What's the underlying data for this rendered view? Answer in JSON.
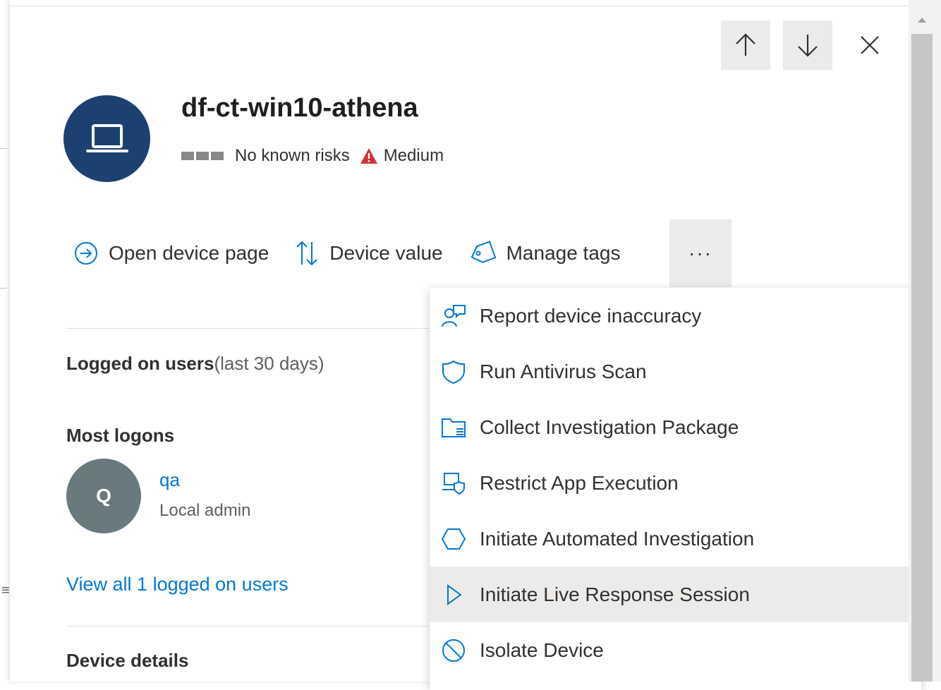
{
  "panel": {
    "nav_up_icon": "arrow-up-icon",
    "nav_down_icon": "arrow-down-icon",
    "close_icon": "close-icon"
  },
  "device": {
    "icon": "laptop-icon",
    "name": "df-ct-win10-athena",
    "risk_text": "No known risks",
    "severity": "Medium",
    "severity_color": "#d13438",
    "avatar_color": "#1c4170"
  },
  "actions": {
    "open_device_page": "Open device page",
    "device_value": "Device value",
    "manage_tags": "Manage tags",
    "more": "···"
  },
  "logged_on": {
    "title_bold": "Logged on users",
    "title_suffix": "(last 30 days)",
    "most_logons_title": "Most logons",
    "user_initial": "Q",
    "user_name": "qa",
    "user_role": "Local admin",
    "view_all": "View all 1 logged on users"
  },
  "device_details": {
    "title": "Device details"
  },
  "menu": {
    "items": [
      {
        "label": "Report device inaccuracy",
        "icon": "person-feedback-icon"
      },
      {
        "label": "Run Antivirus Scan",
        "icon": "shield-icon"
      },
      {
        "label": "Collect Investigation Package",
        "icon": "folder-list-icon"
      },
      {
        "label": "Restrict App Execution",
        "icon": "device-shield-icon"
      },
      {
        "label": "Initiate Automated Investigation",
        "icon": "hexagon-icon"
      },
      {
        "label": "Initiate Live Response Session",
        "icon": "play-icon",
        "highlighted": true
      },
      {
        "label": "Isolate Device",
        "icon": "block-icon"
      }
    ]
  },
  "colors": {
    "accent": "#0078d4",
    "icon_blue": "#0078d4",
    "hover_bg": "#edebe9"
  }
}
